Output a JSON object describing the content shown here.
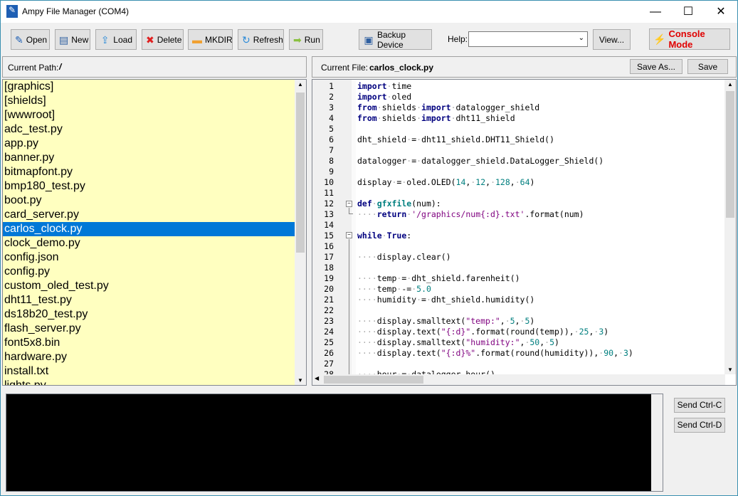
{
  "window": {
    "title": "Ampy File Manager (COM4)",
    "minimize": "—",
    "maximize": "☐",
    "close": "✕"
  },
  "toolbar": {
    "buttons": [
      {
        "label": "Open",
        "icon": "open-icon",
        "glyph": "✎",
        "color": "#1e5fb4"
      },
      {
        "label": "New",
        "icon": "new-file-icon",
        "glyph": "▤",
        "color": "#3060a0"
      },
      {
        "label": "Load",
        "icon": "upload-icon",
        "glyph": "⇪",
        "color": "#2a8ad8"
      },
      {
        "label": "Delete",
        "icon": "delete-icon",
        "glyph": "✖",
        "color": "#e02020"
      },
      {
        "label": "MKDIR",
        "icon": "folder-icon",
        "glyph": "▬",
        "color": "#f0a030"
      },
      {
        "label": "Refresh",
        "icon": "refresh-icon",
        "glyph": "↻",
        "color": "#2a8ad8"
      },
      {
        "label": "Run",
        "icon": "run-arrow-icon",
        "glyph": "➡",
        "color": "#8ac040"
      }
    ],
    "backup_label": "Backup Device",
    "help_label": "Help:",
    "help_value": "",
    "view_label": "View...",
    "console_label": "Console Mode",
    "console_color": "#e00000"
  },
  "left": {
    "path_label": "Current Path:",
    "path_value": "/",
    "files": [
      "[graphics]",
      "[shields]",
      "[wwwroot]",
      "adc_test.py",
      "app.py",
      "banner.py",
      "bitmapfont.py",
      "bmp180_test.py",
      "boot.py",
      "card_server.py",
      "carlos_clock.py",
      "clock_demo.py",
      "config.json",
      "config.py",
      "custom_oled_test.py",
      "dht11_test.py",
      "ds18b20_test.py",
      "flash_server.py",
      "font5x8.bin",
      "hardware.py",
      "install.txt",
      "lights.py"
    ],
    "selected": "carlos_clock.py"
  },
  "right": {
    "file_label": "Current File:",
    "file_value": "carlos_clock.py",
    "save_as": "Save As...",
    "save": "Save"
  },
  "code": [
    [
      [
        "kw",
        "import"
      ],
      [
        "ws",
        "·"
      ],
      [
        "",
        "time"
      ]
    ],
    [
      [
        "kw",
        "import"
      ],
      [
        "ws",
        "·"
      ],
      [
        "",
        "oled"
      ]
    ],
    [
      [
        "kw",
        "from"
      ],
      [
        "ws",
        "·"
      ],
      [
        "",
        "shields"
      ],
      [
        "ws",
        "·"
      ],
      [
        "kw",
        "import"
      ],
      [
        "ws",
        "·"
      ],
      [
        "",
        "datalogger_shield"
      ]
    ],
    [
      [
        "kw",
        "from"
      ],
      [
        "ws",
        "·"
      ],
      [
        "",
        "shields"
      ],
      [
        "ws",
        "·"
      ],
      [
        "kw",
        "import"
      ],
      [
        "ws",
        "·"
      ],
      [
        "",
        "dht11_shield"
      ]
    ],
    [],
    [
      [
        "",
        "dht_shield"
      ],
      [
        "ws",
        "·"
      ],
      [
        "",
        "="
      ],
      [
        "ws",
        "·"
      ],
      [
        "",
        "dht11_shield.DHT11_Shield()"
      ]
    ],
    [],
    [
      [
        "",
        "datalogger"
      ],
      [
        "ws",
        "·"
      ],
      [
        "",
        "="
      ],
      [
        "ws",
        "·"
      ],
      [
        "",
        "datalogger_shield.DataLogger_Shield()"
      ]
    ],
    [],
    [
      [
        "",
        "display"
      ],
      [
        "ws",
        "·"
      ],
      [
        "",
        "="
      ],
      [
        "ws",
        "·"
      ],
      [
        "",
        "oled.OLED("
      ],
      [
        "num",
        "14"
      ],
      [
        "",
        ","
      ],
      [
        "ws",
        "·"
      ],
      [
        "num",
        "12"
      ],
      [
        "",
        ","
      ],
      [
        "ws",
        "·"
      ],
      [
        "num",
        "128"
      ],
      [
        "",
        ","
      ],
      [
        "ws",
        "·"
      ],
      [
        "num",
        "64"
      ],
      [
        "",
        ")"
      ]
    ],
    [],
    [
      [
        "kw",
        "def"
      ],
      [
        "ws",
        "·"
      ],
      [
        "fn",
        "gfxfile"
      ],
      [
        "",
        "(num):"
      ]
    ],
    [
      [
        "ws",
        "····"
      ],
      [
        "kw",
        "return"
      ],
      [
        "ws",
        "·"
      ],
      [
        "str",
        "'/graphics/num{:d}.txt'"
      ],
      [
        "",
        ".format(num)"
      ]
    ],
    [],
    [
      [
        "kw",
        "while"
      ],
      [
        "ws",
        "·"
      ],
      [
        "kw",
        "True"
      ],
      [
        "",
        ":"
      ]
    ],
    [],
    [
      [
        "ws",
        "····"
      ],
      [
        "",
        "display.clear()"
      ]
    ],
    [],
    [
      [
        "ws",
        "····"
      ],
      [
        "",
        "temp"
      ],
      [
        "ws",
        "·"
      ],
      [
        "",
        "="
      ],
      [
        "ws",
        "·"
      ],
      [
        "",
        "dht_shield.farenheit()"
      ]
    ],
    [
      [
        "ws",
        "····"
      ],
      [
        "",
        "temp"
      ],
      [
        "ws",
        "·"
      ],
      [
        "",
        "-="
      ],
      [
        "ws",
        "·"
      ],
      [
        "num",
        "5.0"
      ]
    ],
    [
      [
        "ws",
        "····"
      ],
      [
        "",
        "humidity"
      ],
      [
        "ws",
        "·"
      ],
      [
        "",
        "="
      ],
      [
        "ws",
        "·"
      ],
      [
        "",
        "dht_shield.humidity()"
      ]
    ],
    [],
    [
      [
        "ws",
        "····"
      ],
      [
        "",
        "display.smalltext("
      ],
      [
        "str",
        "\"temp:\""
      ],
      [
        "",
        ","
      ],
      [
        "ws",
        "·"
      ],
      [
        "num",
        "5"
      ],
      [
        "",
        ","
      ],
      [
        "ws",
        "·"
      ],
      [
        "num",
        "5"
      ],
      [
        "",
        ")"
      ]
    ],
    [
      [
        "ws",
        "····"
      ],
      [
        "",
        "display.text("
      ],
      [
        "str",
        "\"{:d}\""
      ],
      [
        "",
        ".format(round(temp)),"
      ],
      [
        "ws",
        "·"
      ],
      [
        "num",
        "25"
      ],
      [
        "",
        ","
      ],
      [
        "ws",
        "·"
      ],
      [
        "num",
        "3"
      ],
      [
        "",
        ")"
      ]
    ],
    [
      [
        "ws",
        "····"
      ],
      [
        "",
        "display.smalltext("
      ],
      [
        "str",
        "\"humidity:\""
      ],
      [
        "",
        ","
      ],
      [
        "ws",
        "·"
      ],
      [
        "num",
        "50"
      ],
      [
        "",
        ","
      ],
      [
        "ws",
        "·"
      ],
      [
        "num",
        "5"
      ],
      [
        "",
        ")"
      ]
    ],
    [
      [
        "ws",
        "····"
      ],
      [
        "",
        "display.text("
      ],
      [
        "str",
        "\"{:d}%\""
      ],
      [
        "",
        ".format(round(humidity)),"
      ],
      [
        "ws",
        "·"
      ],
      [
        "num",
        "90"
      ],
      [
        "",
        ","
      ],
      [
        "ws",
        "·"
      ],
      [
        "num",
        "3"
      ],
      [
        "",
        ")"
      ]
    ],
    [],
    [
      [
        "ws",
        "····"
      ],
      [
        "",
        "hour"
      ],
      [
        "ws",
        "·"
      ],
      [
        "",
        "="
      ],
      [
        "ws",
        "·"
      ],
      [
        "",
        "datalogger.hour()"
      ]
    ]
  ],
  "console": {
    "ctrl_c": "Send Ctrl-C",
    "ctrl_d": "Send Ctrl-D"
  }
}
